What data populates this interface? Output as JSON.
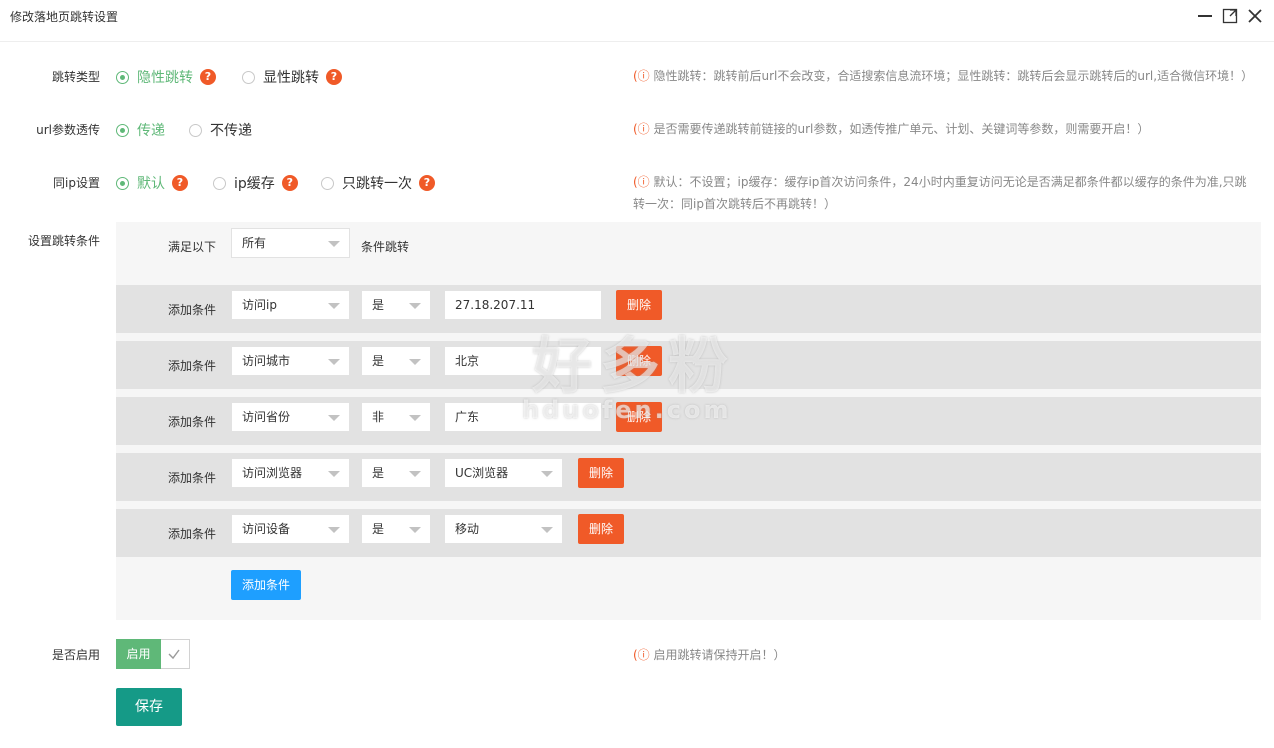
{
  "window": {
    "title": "修改落地页跳转设置",
    "buttons": [
      "minimize",
      "maximize",
      "close"
    ]
  },
  "jump_type": {
    "label": "跳转类型",
    "options": [
      {
        "label": "隐性跳转",
        "checked": true,
        "help": "?"
      },
      {
        "label": "显性跳转",
        "checked": false,
        "help": "?"
      }
    ],
    "hint_icon": "!",
    "hint": "隐性跳转：跳转前后url不会改变，合适搜索信息流环境；显性跳转：跳转后会显示跳转后的url,适合微信环境！）"
  },
  "url_params": {
    "label": "url参数透传",
    "options": [
      {
        "label": "传递",
        "checked": true
      },
      {
        "label": "不传递",
        "checked": false
      }
    ],
    "hint": "是否需要传递跳转前链接的url参数，如透传推广单元、计划、关键词等参数，则需要开启！）"
  },
  "same_ip": {
    "label": "同ip设置",
    "options": [
      {
        "label": "默认",
        "checked": true,
        "help": "?"
      },
      {
        "label": "ip缓存",
        "checked": false,
        "help": "?"
      },
      {
        "label": "只跳转一次",
        "checked": false,
        "help": "?"
      }
    ],
    "hint_line1": "默认：不设置；ip缓存：缓存ip首次访问条件，24小时内重复访问无论是否满足都条件都以缓存的条件为准,只跳",
    "hint_line2": "转一次：同ip首次跳转后不再跳转！）"
  },
  "conditions": {
    "label": "设置跳转条件",
    "match_prefix": "满足以下",
    "match_value": "所有",
    "match_suffix": "条件跳转",
    "row_label": "添加条件",
    "delete_label": "删除",
    "rows": [
      {
        "field": "访问ip",
        "op": "是",
        "value": "27.18.207.11",
        "value_type": "input"
      },
      {
        "field": "访问城市",
        "op": "是",
        "value": "北京",
        "value_type": "input"
      },
      {
        "field": "访问省份",
        "op": "非",
        "value": "广东",
        "value_type": "input"
      },
      {
        "field": "访问浏览器",
        "op": "是",
        "value": "UC浏览器",
        "value_type": "select"
      },
      {
        "field": "访问设备",
        "op": "是",
        "value": "移动",
        "value_type": "select"
      }
    ],
    "add_button": "添加条件"
  },
  "enable": {
    "label": "是否启用",
    "switch_label": "启用",
    "enabled": true,
    "hint": "启用跳转请保持开启！）"
  },
  "save_button": "保存",
  "watermark": {
    "main": "好多粉",
    "sub": "hduofen.com"
  },
  "colors": {
    "green": "#5fb878",
    "orange": "#f05a28",
    "blue": "#1e9fff",
    "teal": "#159a87"
  }
}
